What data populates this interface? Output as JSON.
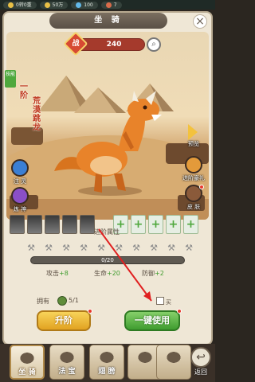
{
  "topbar": {
    "item1": "0转0重",
    "item2": "50万",
    "item3": "100",
    "item4": "7"
  },
  "panel": {
    "title": "坐 骑",
    "power_label": "战",
    "power_value": "240"
  },
  "mount": {
    "rank": "一阶",
    "name": "荒漠跳龙",
    "green_tag": "技能"
  },
  "side_left": [
    {
      "label": "注 灵",
      "icon": "spirit-icon",
      "color": "#3b7fd4"
    },
    {
      "label": "炼 神",
      "icon": "refine-icon",
      "color": "#8a4fc7"
    }
  ],
  "side_right": [
    {
      "label": "预览",
      "icon": "preview-icon"
    },
    {
      "label": "进阶豪礼",
      "icon": "gift-icon"
    },
    {
      "label": "皮 肤",
      "icon": "skin-icon"
    }
  ],
  "skills": {
    "plus": "+"
  },
  "advance": {
    "title": "进阶属性",
    "progress_text": "0/20",
    "progress": 0,
    "stats": [
      {
        "label": "攻击",
        "value": "+8"
      },
      {
        "label": "生命",
        "value": "+20"
      },
      {
        "label": "防御",
        "value": "+2"
      }
    ],
    "owned_label": "拥有",
    "owned_count": "5/1",
    "auto_buy_label": "买"
  },
  "buttons": {
    "advance": "升阶",
    "one_click": "一键使用"
  },
  "nav": {
    "items": [
      {
        "label": "坐 骑",
        "icon": "mount-icon"
      },
      {
        "label": "法 宝",
        "icon": "treasure-icon"
      },
      {
        "label": "翅 膀",
        "icon": "wings-icon"
      },
      {
        "label": "",
        "icon": "item4-icon"
      },
      {
        "label": "",
        "icon": "item5-icon"
      }
    ],
    "back": "返回"
  }
}
